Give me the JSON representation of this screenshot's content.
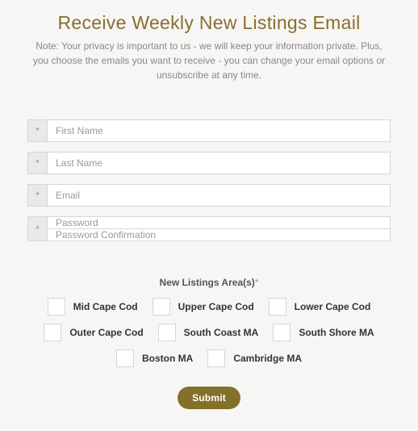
{
  "heading": "Receive Weekly New Listings Email",
  "note": "Note: Your privacy is important to us - we will keep your information private. Plus, you choose the emails you want to receive - you can change your email options or unsubscribe at any time.",
  "required_mark": "*",
  "fields": {
    "first_name": {
      "placeholder": "First Name",
      "value": ""
    },
    "last_name": {
      "placeholder": "Last Name",
      "value": ""
    },
    "email": {
      "placeholder": "Email",
      "value": ""
    },
    "password": {
      "placeholder": "Password",
      "value": ""
    },
    "password_confirmation": {
      "placeholder": "Password Confirmation",
      "value": ""
    }
  },
  "areas_label": "New Listings Area(s)",
  "areas": [
    "Mid Cape Cod",
    "Upper Cape Cod",
    "Lower Cape Cod",
    "Outer Cape Cod",
    "South Coast MA",
    "South Shore MA",
    "Boston MA",
    "Cambridge MA"
  ],
  "submit_label": "Submit"
}
